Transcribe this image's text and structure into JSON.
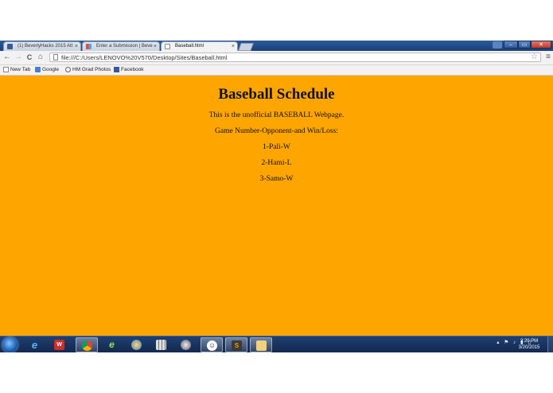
{
  "browser": {
    "tabs": [
      {
        "label": "(1) BeverlyHacks 2015 Att",
        "close": "×",
        "active": false
      },
      {
        "label": "Enter a Submission | Beve",
        "close": "×",
        "active": false
      },
      {
        "label": "Baseball.html",
        "close": "×",
        "active": true
      }
    ],
    "url": "file:///C:/Users/LENOVO%20V570/Desktop/Sites/Baseball.html",
    "nav": {
      "back": "←",
      "forward": "→",
      "reload": "C",
      "home": "⌂"
    },
    "star": "☆",
    "menu": "≡",
    "window_controls": {
      "minimize": "–",
      "maximize": "▭",
      "close": "✕"
    }
  },
  "bookmarks": [
    {
      "label": "New Tab",
      "icon": "page-icon"
    },
    {
      "label": "Google",
      "icon": "google-icon"
    },
    {
      "label": "HM Grad Photos",
      "icon": "link-icon"
    },
    {
      "label": "Facebook",
      "icon": "facebook-icon"
    }
  ],
  "page": {
    "title": "Baseball Schedule",
    "intro": "This is the unofficial BASEBALL Webpage.",
    "legend": "Game Number-Opponent-and Win/Loss:",
    "games": [
      "1-Pali-W",
      "2-Hami-L",
      "3-Samo-W"
    ],
    "background_color": "#ffa500"
  },
  "taskbar": {
    "clock_time": "2:20 PM",
    "clock_date": "3/20/2015"
  }
}
